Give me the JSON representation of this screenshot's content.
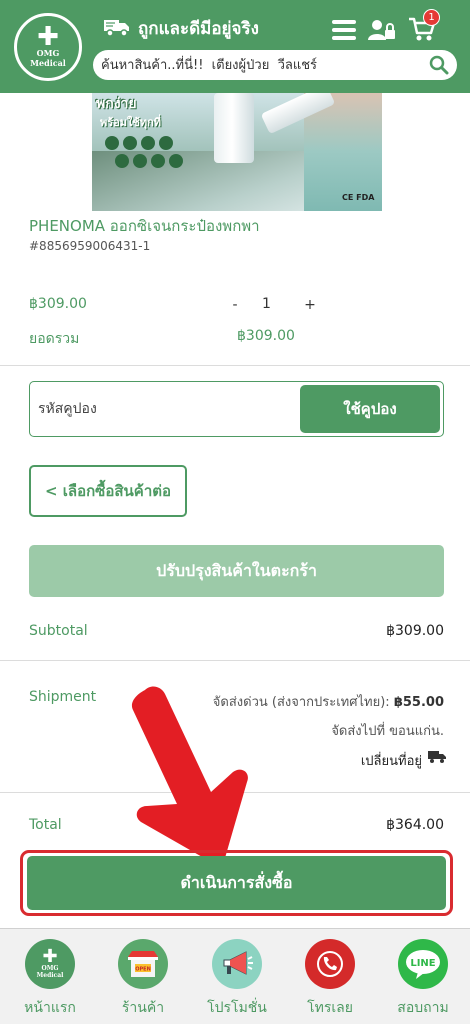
{
  "header": {
    "logo_line1": "OMG",
    "logo_line2": "Medical",
    "tagline": "ถูกและดีมีอยู่จริง",
    "cart_count": "1",
    "search_placeholder": "ค้นหาสินค้า..ที่นี่!!  เตียงผู้ป่วย  วีลแชร์"
  },
  "product": {
    "promo_text_line1": "พกง่าย",
    "promo_text_line2": "พร้อมใช้ทุกที่",
    "certification": "CE FDA",
    "name": "PHENOMA ออกซิเจนกระป๋องพกพา",
    "sku": "#8856959006431-1",
    "price": "฿309.00",
    "qty_minus": "-",
    "quantity": "1",
    "qty_plus": "+",
    "subtotal_label": "ยอดรวม",
    "line_total": "฿309.00"
  },
  "coupon": {
    "placeholder": "รหัสคูปอง",
    "apply_label": "ใช้คูปอง"
  },
  "actions": {
    "continue_label": "< เลือกซื้อสินค้าต่อ",
    "update_cart_label": "ปรับปรุงสินค้าในตะกร้า",
    "checkout_label": "ดำเนินการสั่งซื้อ"
  },
  "totals": {
    "subtotal_label": "Subtotal",
    "subtotal_value": "฿309.00",
    "shipment_label": "Shipment",
    "shipping_method_text": "จัดส่งด่วน (ส่งจากประเทศไทย):",
    "shipping_method_price": "฿55.00",
    "shipping_destination": "จัดส่งไปที่ ขอนแก่น.",
    "change_address_label": "เปลี่ยนที่อยู่",
    "total_label": "Total",
    "total_value": "฿364.00"
  },
  "bottom_nav": {
    "items": [
      {
        "label": "หน้าแรก",
        "icon": "home-logo-icon"
      },
      {
        "label": "ร้านค้า",
        "icon": "shop-icon"
      },
      {
        "label": "โปรโมชั่น",
        "icon": "megaphone-icon"
      },
      {
        "label": "โทรเลย",
        "icon": "phone-icon"
      },
      {
        "label": "สอบถาม",
        "icon": "line-chat-icon"
      }
    ],
    "home_logo_line1": "OMG",
    "home_logo_line2": "Medical",
    "line_text": "LINE",
    "shop_sign": "OPEN"
  },
  "colors": {
    "brand_green": "#4e9a63",
    "update_button_green": "#9ccaa8",
    "badge_red": "#e53935",
    "highlight_red": "#d92b30"
  }
}
